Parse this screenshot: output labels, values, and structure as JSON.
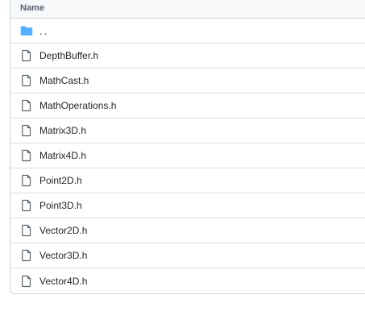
{
  "table": {
    "header_label": "Name",
    "parent_dir": "..",
    "files": [
      "DepthBuffer.h",
      "MathCast.h",
      "MathOperations.h",
      "Matrix3D.h",
      "Matrix4D.h",
      "Point2D.h",
      "Point3D.h",
      "Vector2D.h",
      "Vector3D.h",
      "Vector4D.h"
    ]
  },
  "colors": {
    "folder": "#54aeff",
    "file_icon": "#59636e",
    "border": "#d0d7de",
    "header_bg": "#f6f8fa"
  }
}
